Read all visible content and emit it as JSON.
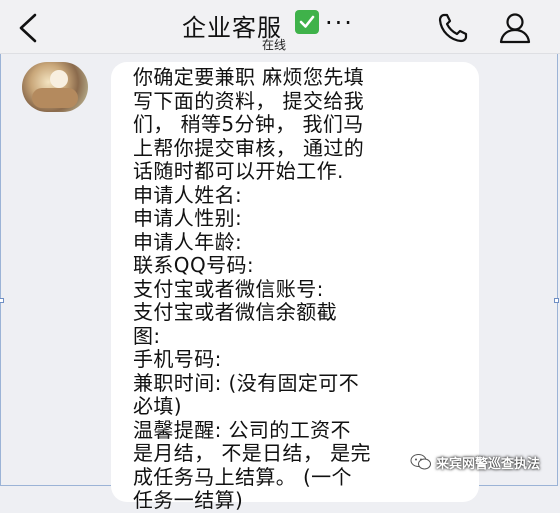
{
  "header": {
    "back_icon": "chevron-left-icon",
    "title": "企业客服",
    "verified_icon": "check-mark-badge-icon",
    "more": "...",
    "status": "在线",
    "call_icon": "phone-icon",
    "profile_icon": "person-icon"
  },
  "message": {
    "avatar_icon": "contact-avatar",
    "lines": [
      "你确定要兼职 麻烦您先填",
      "写下面的资料， 提交给我",
      "们， 稍等5分钟， 我们马",
      "上帮你提交审核， 通过的",
      "话随时都可以开始工作.",
      "申请人姓名:",
      "申请人性别:",
      "申请人年龄:",
      "联系QQ号码:",
      "支付宝或者微信账号:",
      "支付宝或者微信余额截",
      "图:",
      "手机号码:",
      "兼职时间: (没有固定可不",
      "必填)",
      "温馨提醒: 公司的工资不",
      "是月结， 不是日结， 是完",
      "成任务马上结算。 (一个",
      "任务一结算)"
    ]
  },
  "watermark": {
    "icon": "wechat-logo-icon",
    "text": "来宾网警巡查执法"
  },
  "colors": {
    "background": "#eeeff3",
    "bubble": "#ffffff",
    "verified": "#3fb24a"
  }
}
